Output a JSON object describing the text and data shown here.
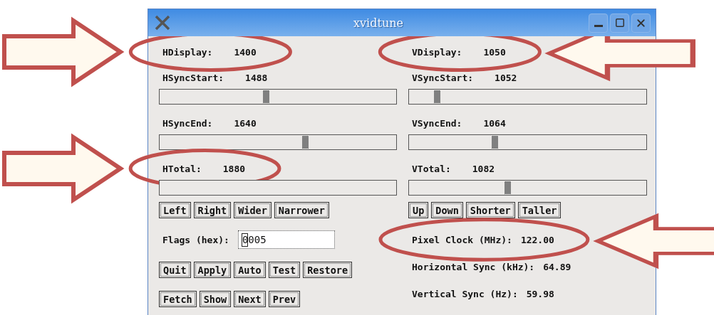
{
  "window": {
    "title": "xvidtune"
  },
  "horizontal": {
    "params": [
      {
        "kind": "readout",
        "label": "HDisplay:",
        "value": "1400",
        "circled": true
      },
      {
        "kind": "slider",
        "label": "HSyncStart:",
        "value": "1488",
        "level": 0.45,
        "circled": false
      },
      {
        "kind": "slider",
        "label": "HSyncEnd:",
        "value": "1640",
        "level": 0.615,
        "circled": false
      },
      {
        "kind": "slider",
        "label": "HTotal:",
        "value": "1880",
        "circled": true
      }
    ],
    "buttons": [
      "Left",
      "Right",
      "Wider",
      "Narrower"
    ]
  },
  "vertical": {
    "params": [
      {
        "kind": "readout",
        "label": "VDisplay:",
        "value": "1050",
        "circled": true
      },
      {
        "kind": "slider",
        "label": "VSyncStart:",
        "value": "1052",
        "level": 0.118,
        "circled": false
      },
      {
        "kind": "slider",
        "label": "VSyncEnd:",
        "value": "1064",
        "level": 0.36,
        "circled": false
      },
      {
        "kind": "slider",
        "label": "VTotal:",
        "value": "1082",
        "level": 0.413,
        "circled": false
      }
    ],
    "buttons": [
      "Up",
      "Down",
      "Shorter",
      "Taller"
    ]
  },
  "flags": {
    "label": "Flags (hex):",
    "value": "0005"
  },
  "action_rows": [
    [
      "Quit",
      "Apply",
      "Auto",
      "Test",
      "Restore"
    ],
    [
      "Fetch",
      "Show",
      "Next",
      "Prev"
    ]
  ],
  "readouts": [
    {
      "label": "Pixel Clock (MHz):",
      "value": "122.00",
      "circled": true
    },
    {
      "label": "Horizontal Sync (kHz):",
      "value": "64.89",
      "circled": false
    },
    {
      "label": "Vertical Sync (Hz):",
      "value": "59.98",
      "circled": false
    }
  ]
}
